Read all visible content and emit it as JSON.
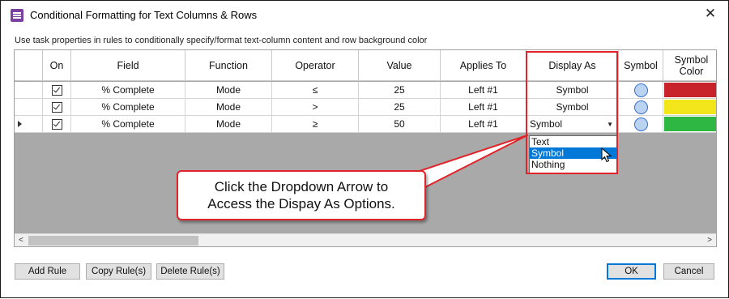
{
  "window": {
    "title": "Conditional Formatting for Text Columns & Rows",
    "close_label": "✕"
  },
  "hint": "Use task properties in rules to conditionally specify/format text-column content and row background color",
  "columns": [
    "On",
    "Field",
    "Function",
    "Operator",
    "Value",
    "Applies To",
    "Display As",
    "Symbol",
    "Symbol Color"
  ],
  "rows": [
    {
      "field": "% Complete",
      "function": "Mode",
      "operator": "≤",
      "value": "25",
      "applies_to": "Left #1",
      "display_as": "Symbol",
      "symbol_color": "#c8222a"
    },
    {
      "field": "% Complete",
      "function": "Mode",
      "operator": ">",
      "value": "25",
      "applies_to": "Left #1",
      "display_as": "Symbol",
      "symbol_color": "#f2e61a"
    },
    {
      "field": "% Complete",
      "function": "Mode",
      "operator": "≥",
      "value": "50",
      "applies_to": "Left #1",
      "display_as": "Symbol",
      "symbol_color": "#2eb843"
    }
  ],
  "dropdown": {
    "options": [
      "Text",
      "Symbol",
      "Nothing"
    ],
    "highlighted": "Symbol"
  },
  "callout": {
    "line1": "Click the Dropdown Arrow to",
    "line2": "Access the Dispay As Options."
  },
  "buttons": {
    "add_rule": "Add Rule",
    "copy_rules": "Copy Rule(s)",
    "delete_rules": "Delete Rule(s)",
    "ok": "OK",
    "cancel": "Cancel"
  },
  "colors": {
    "accent_red": "#e0242a",
    "selection_blue": "#0078d7"
  }
}
